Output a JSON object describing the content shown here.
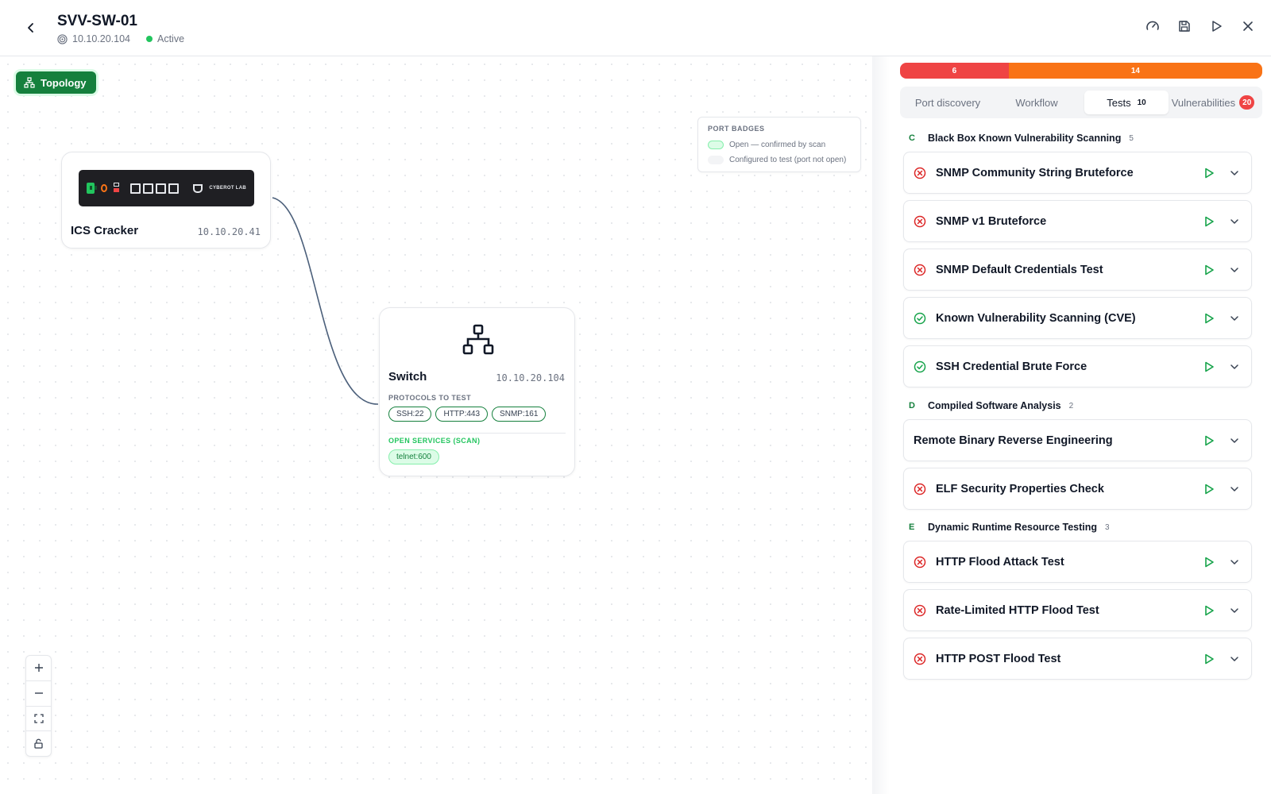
{
  "header": {
    "title": "SVV-SW-01",
    "ip": "10.10.20.104",
    "status": "Active"
  },
  "canvas": {
    "topology_label": "Topology",
    "legend": {
      "title": "PORT BADGES",
      "open_label": "Open — confirmed by scan",
      "configured_label": "Configured to test (port not open)"
    },
    "ics_node": {
      "name": "ICS Cracker",
      "ip": "10.10.20.41",
      "device_brand": "CYBEROT LAB"
    },
    "switch_node": {
      "name": "Switch",
      "ip": "10.10.20.104",
      "protocols_label": "PROTOCOLS TO TEST",
      "protocols": [
        "SSH:22",
        "HTTP:443",
        "SNMP:161"
      ],
      "open_label": "OPEN SERVICES (SCAN)",
      "open_services": [
        "telnet:600"
      ]
    }
  },
  "panel": {
    "severity": [
      {
        "label": "6",
        "fraction": 0.3,
        "color": "#ef4444"
      },
      {
        "label": "14",
        "fraction": 0.7,
        "color": "#f97316"
      }
    ],
    "tabs": {
      "port_discovery": "Port discovery",
      "workflow": "Workflow",
      "tests": "Tests",
      "tests_count": "10",
      "vulnerabilities": "Vulnerabilities",
      "vulnerabilities_count": "20"
    },
    "groups": [
      {
        "letter": "C",
        "title": "Black Box Known Vulnerability Scanning",
        "count": "5",
        "tests": [
          {
            "name": "SNMP Community String Bruteforce",
            "status": "failed"
          },
          {
            "name": "SNMP v1 Bruteforce",
            "status": "failed"
          },
          {
            "name": "SNMP Default Credentials Test",
            "status": "failed"
          },
          {
            "name": "Known Vulnerability Scanning (CVE)",
            "status": "passed"
          },
          {
            "name": "SSH Credential Brute Force",
            "status": "passed"
          }
        ]
      },
      {
        "letter": "D",
        "title": "Compiled Software Analysis",
        "count": "2",
        "tests": [
          {
            "name": "Remote Binary Reverse Engineering",
            "status": "none"
          },
          {
            "name": "ELF Security Properties Check",
            "status": "failed"
          }
        ]
      },
      {
        "letter": "E",
        "title": "Dynamic Runtime Resource Testing",
        "count": "3",
        "tests": [
          {
            "name": "HTTP Flood Attack Test",
            "status": "failed"
          },
          {
            "name": "Rate-Limited HTTP Flood Test",
            "status": "failed"
          },
          {
            "name": "HTTP POST Flood Test",
            "status": "failed"
          }
        ]
      }
    ]
  },
  "colors": {
    "accent": "#15803d",
    "failed": "#dc2626",
    "passed": "#16a34a",
    "critical": "#ef4444",
    "high": "#f97316"
  }
}
